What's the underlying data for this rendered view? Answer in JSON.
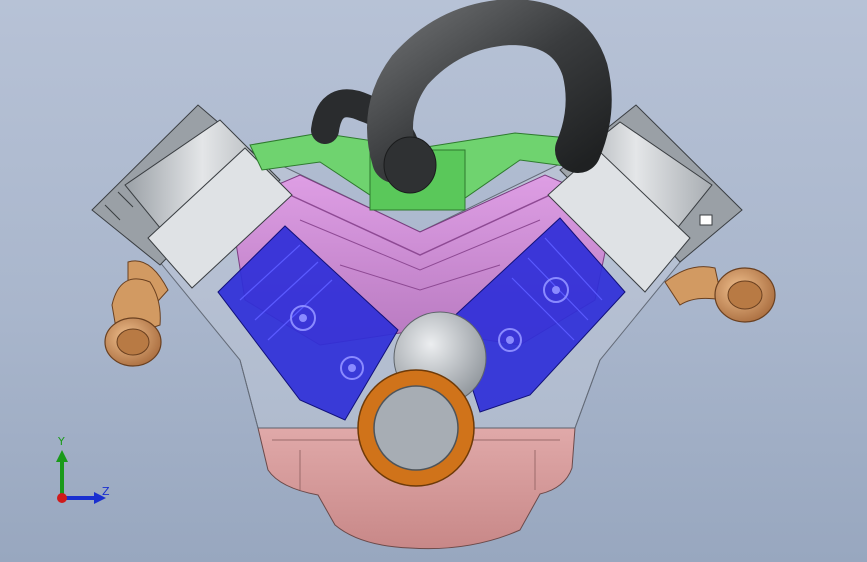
{
  "viewport": {
    "background_top": "#b7c2d6",
    "background_bottom": "#98a7bf"
  },
  "model": {
    "components": [
      "breather-hose",
      "intake-manifold",
      "left-cylinder-head",
      "right-cylinder-head",
      "engine-block",
      "left-piston-bank",
      "right-piston-bank",
      "crankshaft-bearing",
      "oil-pan",
      "left-exhaust-elbow",
      "right-exhaust-elbow"
    ],
    "colors": {
      "hose": "#3b3d3f",
      "manifold": "#6fd36f",
      "block": "#d08ad6",
      "pistons": "#2b2bd6",
      "heads": "#cfcfcf",
      "bearing": "#d0731a",
      "oil_pan": "#d69a9a",
      "exhaust": "#d29a62"
    }
  },
  "triad": {
    "y_label": "Y",
    "z_label": "Z",
    "y_color": "#1a9a1a",
    "z_color": "#1a2fd0",
    "origin_color": "#d01a1a"
  }
}
